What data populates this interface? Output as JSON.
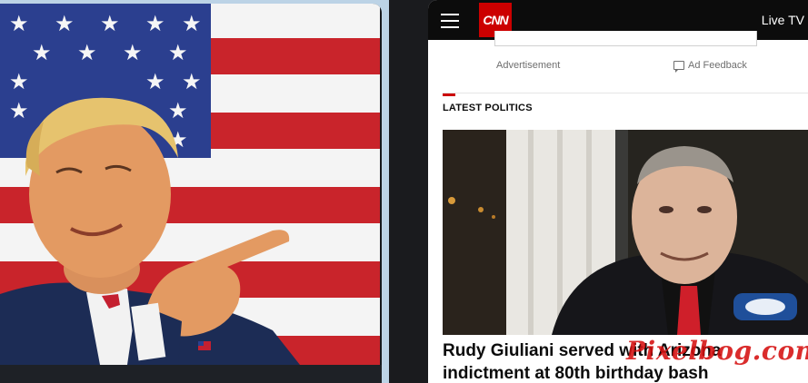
{
  "left_panel": {
    "image_description_icon": "photo-person-pointing-flag"
  },
  "cnn": {
    "logo_text": "CNN",
    "live_tv": "Live TV",
    "advertisement_label": "Advertisement",
    "ad_feedback_label": "Ad Feedback",
    "section_title": "LATEST POLITICS",
    "headline": "Rudy Giuliani served with Arizona indictment at 80th birthday bash",
    "accent_color": "#cc0000"
  },
  "watermark": "Pixelbog.com"
}
